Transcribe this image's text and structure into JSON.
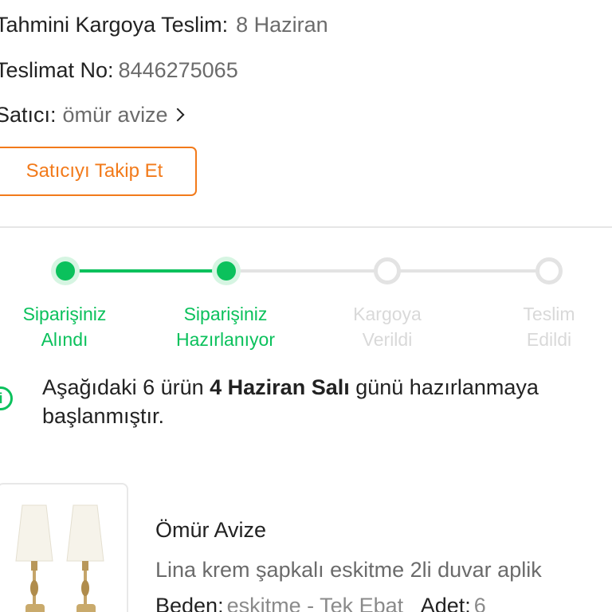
{
  "shipment": {
    "eta_label": "Tahmini Kargoya Teslim:",
    "eta_value": "8 Haziran",
    "delivery_no_label": "Teslimat No:",
    "delivery_no_value": "8446275065",
    "seller_label": "Satıcı:",
    "seller_value": "ömür avize",
    "follow_button": "Satıcıyı Takip Et"
  },
  "stepper": {
    "active_color": "#0bc15c",
    "inactive_color": "#d9d9d9",
    "steps": [
      {
        "line1": "Siparişiniz",
        "line2": "Alındı",
        "state": "done"
      },
      {
        "line1": "Siparişiniz",
        "line2": "Hazırlanıyor",
        "state": "done"
      },
      {
        "line1": "Kargoya",
        "line2": "Verildi",
        "state": "todo"
      },
      {
        "line1": "Teslim",
        "line2": "Edildi",
        "state": "todo"
      }
    ]
  },
  "notice": {
    "prefix": "Aşağıdaki 6 ürün ",
    "highlight": "4 Haziran Salı",
    "suffix": " günü hazırlanmaya başlanmıştır."
  },
  "product": {
    "brand": "Ömür Avize",
    "name": "Lina krem şapkalı eskitme 2li duvar aplik",
    "size_label": "Beden:",
    "size_value": "eskitme - Tek Ebat",
    "qty_label": "Adet:",
    "qty_value": "6"
  },
  "colors": {
    "accent_orange": "#f27a1a",
    "success_green": "#0bc15c"
  }
}
